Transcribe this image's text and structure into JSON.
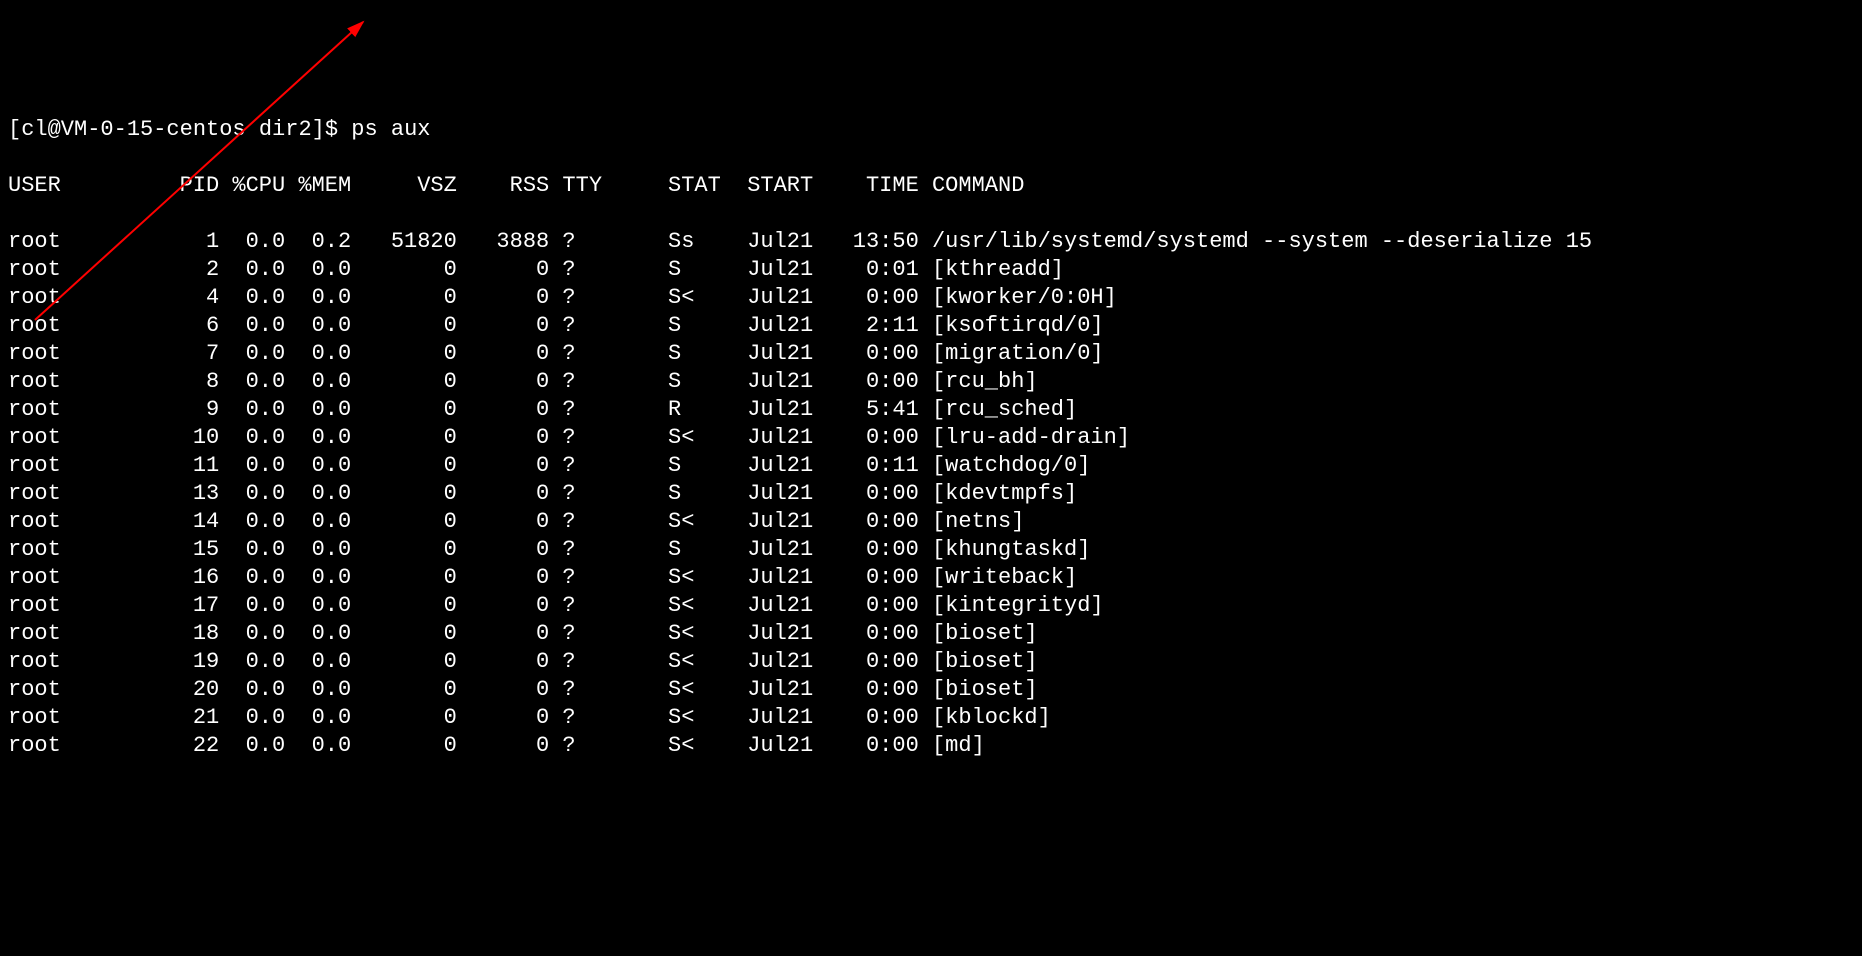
{
  "prompt": "[cl@VM-0-15-centos dir2]$ ps aux",
  "headers": {
    "user": "USER",
    "pid": "PID",
    "cpu": "%CPU",
    "mem": "%MEM",
    "vsz": "VSZ",
    "rss": "RSS",
    "tty": "TTY",
    "stat": "STAT",
    "start": "START",
    "time": "TIME",
    "command": "COMMAND"
  },
  "rows": [
    {
      "user": "root",
      "pid": "1",
      "cpu": "0.0",
      "mem": "0.2",
      "vsz": "51820",
      "rss": "3888",
      "tty": "?",
      "stat": "Ss",
      "start": "Jul21",
      "time": "13:50",
      "cmd": "/usr/lib/systemd/systemd --system --deserialize 15"
    },
    {
      "user": "root",
      "pid": "2",
      "cpu": "0.0",
      "mem": "0.0",
      "vsz": "0",
      "rss": "0",
      "tty": "?",
      "stat": "S",
      "start": "Jul21",
      "time": "0:01",
      "cmd": "[kthreadd]"
    },
    {
      "user": "root",
      "pid": "4",
      "cpu": "0.0",
      "mem": "0.0",
      "vsz": "0",
      "rss": "0",
      "tty": "?",
      "stat": "S<",
      "start": "Jul21",
      "time": "0:00",
      "cmd": "[kworker/0:0H]"
    },
    {
      "user": "root",
      "pid": "6",
      "cpu": "0.0",
      "mem": "0.0",
      "vsz": "0",
      "rss": "0",
      "tty": "?",
      "stat": "S",
      "start": "Jul21",
      "time": "2:11",
      "cmd": "[ksoftirqd/0]"
    },
    {
      "user": "root",
      "pid": "7",
      "cpu": "0.0",
      "mem": "0.0",
      "vsz": "0",
      "rss": "0",
      "tty": "?",
      "stat": "S",
      "start": "Jul21",
      "time": "0:00",
      "cmd": "[migration/0]"
    },
    {
      "user": "root",
      "pid": "8",
      "cpu": "0.0",
      "mem": "0.0",
      "vsz": "0",
      "rss": "0",
      "tty": "?",
      "stat": "S",
      "start": "Jul21",
      "time": "0:00",
      "cmd": "[rcu_bh]"
    },
    {
      "user": "root",
      "pid": "9",
      "cpu": "0.0",
      "mem": "0.0",
      "vsz": "0",
      "rss": "0",
      "tty": "?",
      "stat": "R",
      "start": "Jul21",
      "time": "5:41",
      "cmd": "[rcu_sched]"
    },
    {
      "user": "root",
      "pid": "10",
      "cpu": "0.0",
      "mem": "0.0",
      "vsz": "0",
      "rss": "0",
      "tty": "?",
      "stat": "S<",
      "start": "Jul21",
      "time": "0:00",
      "cmd": "[lru-add-drain]"
    },
    {
      "user": "root",
      "pid": "11",
      "cpu": "0.0",
      "mem": "0.0",
      "vsz": "0",
      "rss": "0",
      "tty": "?",
      "stat": "S",
      "start": "Jul21",
      "time": "0:11",
      "cmd": "[watchdog/0]"
    },
    {
      "user": "root",
      "pid": "13",
      "cpu": "0.0",
      "mem": "0.0",
      "vsz": "0",
      "rss": "0",
      "tty": "?",
      "stat": "S",
      "start": "Jul21",
      "time": "0:00",
      "cmd": "[kdevtmpfs]"
    },
    {
      "user": "root",
      "pid": "14",
      "cpu": "0.0",
      "mem": "0.0",
      "vsz": "0",
      "rss": "0",
      "tty": "?",
      "stat": "S<",
      "start": "Jul21",
      "time": "0:00",
      "cmd": "[netns]"
    },
    {
      "user": "root",
      "pid": "15",
      "cpu": "0.0",
      "mem": "0.0",
      "vsz": "0",
      "rss": "0",
      "tty": "?",
      "stat": "S",
      "start": "Jul21",
      "time": "0:00",
      "cmd": "[khungtaskd]"
    },
    {
      "user": "root",
      "pid": "16",
      "cpu": "0.0",
      "mem": "0.0",
      "vsz": "0",
      "rss": "0",
      "tty": "?",
      "stat": "S<",
      "start": "Jul21",
      "time": "0:00",
      "cmd": "[writeback]"
    },
    {
      "user": "root",
      "pid": "17",
      "cpu": "0.0",
      "mem": "0.0",
      "vsz": "0",
      "rss": "0",
      "tty": "?",
      "stat": "S<",
      "start": "Jul21",
      "time": "0:00",
      "cmd": "[kintegrityd]"
    },
    {
      "user": "root",
      "pid": "18",
      "cpu": "0.0",
      "mem": "0.0",
      "vsz": "0",
      "rss": "0",
      "tty": "?",
      "stat": "S<",
      "start": "Jul21",
      "time": "0:00",
      "cmd": "[bioset]"
    },
    {
      "user": "root",
      "pid": "19",
      "cpu": "0.0",
      "mem": "0.0",
      "vsz": "0",
      "rss": "0",
      "tty": "?",
      "stat": "S<",
      "start": "Jul21",
      "time": "0:00",
      "cmd": "[bioset]"
    },
    {
      "user": "root",
      "pid": "20",
      "cpu": "0.0",
      "mem": "0.0",
      "vsz": "0",
      "rss": "0",
      "tty": "?",
      "stat": "S<",
      "start": "Jul21",
      "time": "0:00",
      "cmd": "[bioset]"
    },
    {
      "user": "root",
      "pid": "21",
      "cpu": "0.0",
      "mem": "0.0",
      "vsz": "0",
      "rss": "0",
      "tty": "?",
      "stat": "S<",
      "start": "Jul21",
      "time": "0:00",
      "cmd": "[kblockd]"
    },
    {
      "user": "root",
      "pid": "22",
      "cpu": "0.0",
      "mem": "0.0",
      "vsz": "0",
      "rss": "0",
      "tty": "?",
      "stat": "S<",
      "start": "Jul21",
      "time": "0:00",
      "cmd": "[md]"
    }
  ],
  "arrow": {
    "color": "#ff0000"
  }
}
